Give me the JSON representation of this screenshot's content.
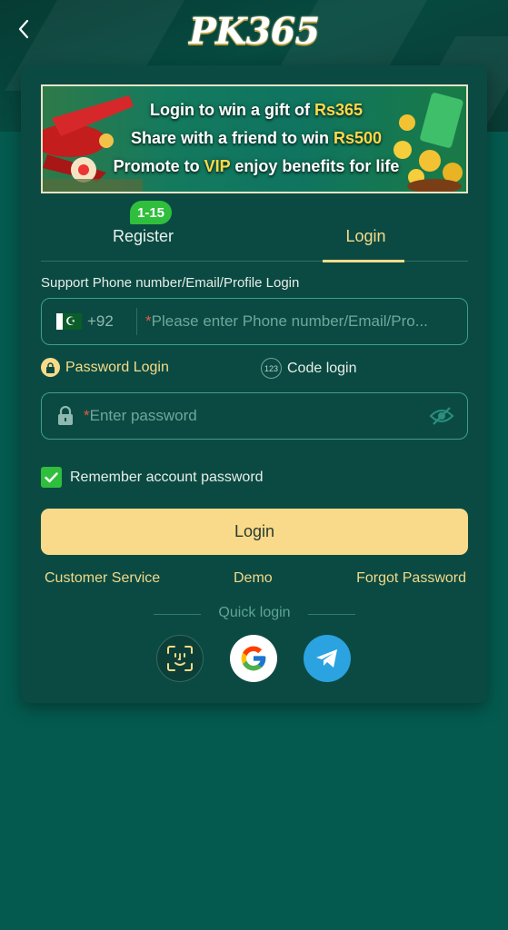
{
  "header": {
    "logo_text": "PK365"
  },
  "banner": {
    "line1_prefix": "Login to win a gift of ",
    "line1_highlight": "Rs365",
    "line2_prefix": "Share with a friend to win ",
    "line2_highlight": "Rs500",
    "line3_prefix": "Promote to ",
    "line3_highlight": "VIP",
    "line3_suffix": " enjoy benefits for life"
  },
  "tabs": {
    "register_label": "Register",
    "register_badge": "1-15",
    "login_label": "Login",
    "active": "Login"
  },
  "form": {
    "account_label": "Support Phone number/Email/Profile Login",
    "country_code": "+92",
    "account_placeholder": "Please enter Phone number/Email/Pro...",
    "required_mark": "*",
    "mode_password": "Password Login",
    "mode_code": "Code login",
    "mode_code_icon_text": "123",
    "password_placeholder": "Enter password",
    "remember_label": "Remember account password",
    "remember_checked": true,
    "login_button": "Login"
  },
  "links": {
    "customer_service": "Customer Service",
    "demo": "Demo",
    "forgot_password": "Forgot Password"
  },
  "quick_login": {
    "label": "Quick login",
    "options": [
      "face-id-icon",
      "google-icon",
      "telegram-icon"
    ]
  },
  "colors": {
    "background": "#045a4f",
    "card": "#0b4a42",
    "accent_gold": "#f6dc8a",
    "input_border": "#3c9f8d",
    "checkbox_green": "#2fbf3d"
  }
}
